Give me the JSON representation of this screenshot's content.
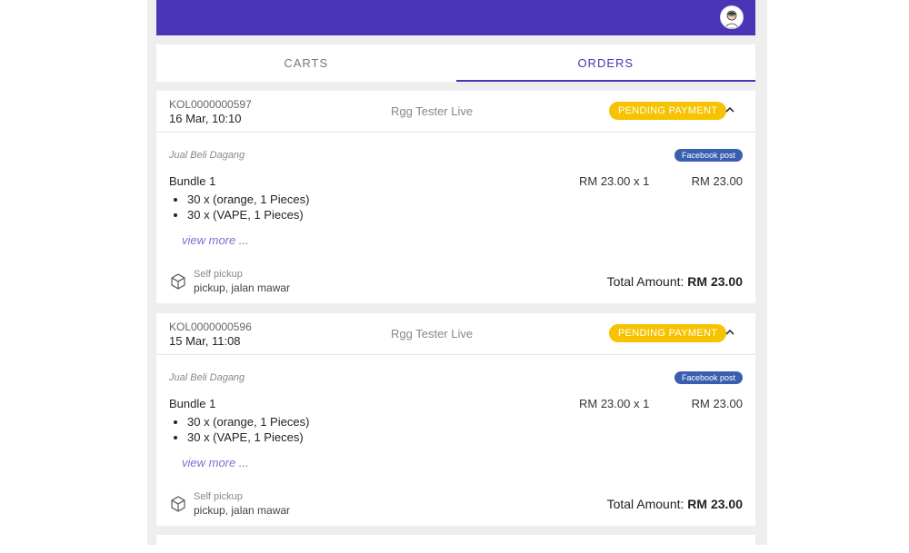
{
  "tabs": [
    {
      "label": "CARTS",
      "active": false
    },
    {
      "label": "ORDERS",
      "active": true
    }
  ],
  "orders": [
    {
      "id": "KOL0000000597",
      "date": "16 Mar, 10:10",
      "shop": "Rgg Tester Live",
      "status": "PENDING PAYMENT",
      "seller": "Jual Beli Dagang",
      "source": "Facebook post",
      "bundle": "Bundle 1",
      "unit_price": "RM 23.00 x 1",
      "price": "RM 23.00",
      "items": [
        "30 x (orange, 1 Pieces)",
        "30 x (VAPE, 1 Pieces)"
      ],
      "view_more": "view more ...",
      "pickup_method": "Self pickup",
      "pickup_address": "pickup, jalan mawar",
      "total_label": "Total Amount:",
      "total": "RM 23.00"
    },
    {
      "id": "KOL0000000596",
      "date": "15 Mar, 11:08",
      "shop": "Rgg Tester Live",
      "status": "PENDING PAYMENT",
      "seller": "Jual Beli Dagang",
      "source": "Facebook post",
      "bundle": "Bundle 1",
      "unit_price": "RM 23.00 x 1",
      "price": "RM 23.00",
      "items": [
        "30 x (orange, 1 Pieces)",
        "30 x (VAPE, 1 Pieces)"
      ],
      "view_more": "view more ...",
      "pickup_method": "Self pickup",
      "pickup_address": "pickup, jalan mawar",
      "total_label": "Total Amount:",
      "total": "RM 23.00"
    }
  ],
  "colors": {
    "header": "#4a35b7",
    "status": "#f7c300",
    "source_badge": "#3a5fb0",
    "link": "#7d6fd0"
  }
}
